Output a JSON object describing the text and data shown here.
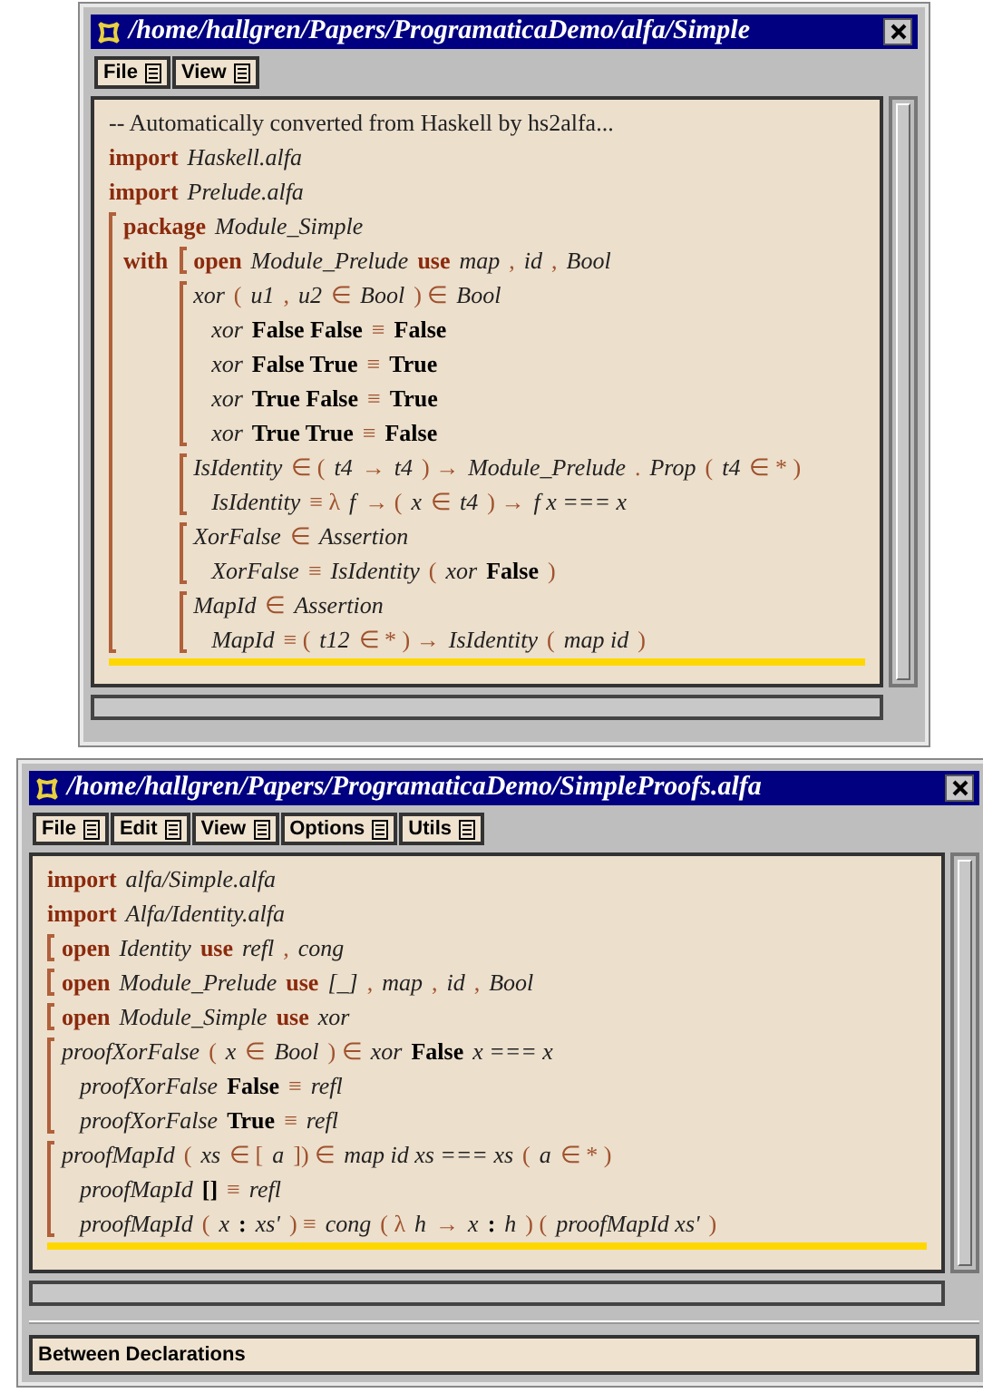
{
  "windows": [
    {
      "title": "/home/hallgren/Papers/ProgramaticaDemo/alfa/Simple",
      "menus": [
        {
          "label": "File"
        },
        {
          "label": "View"
        }
      ],
      "code": [
        {
          "kind": "line",
          "tokens": [
            {
              "kind": "txt",
              "text": "-- Automatically converted from Haskell by hs2alfa..."
            }
          ]
        },
        {
          "kind": "line",
          "tokens": [
            {
              "kind": "kw",
              "text": "import"
            },
            {
              "kind": "id",
              "text": "Haskell.alfa"
            }
          ]
        },
        {
          "kind": "line",
          "tokens": [
            {
              "kind": "kw",
              "text": "import"
            },
            {
              "kind": "id",
              "text": "Prelude.alfa"
            }
          ]
        },
        {
          "kind": "block",
          "children": [
            {
              "kind": "line",
              "tokens": [
                {
                  "kind": "kw",
                  "text": "package"
                },
                {
                  "kind": "id",
                  "text": "Module_Simple"
                }
              ]
            },
            {
              "kind": "lead",
              "tokens": [
                {
                  "kind": "kw",
                  "text": "with"
                }
              ],
              "children": [
                {
                  "kind": "block",
                  "children": [
                    {
                      "kind": "line",
                      "tokens": [
                        {
                          "kind": "kw",
                          "text": "open"
                        },
                        {
                          "kind": "id",
                          "text": "Module_Prelude"
                        },
                        {
                          "kind": "kw",
                          "text": "use"
                        },
                        {
                          "kind": "id",
                          "text": "map"
                        },
                        {
                          "kind": "sym",
                          "text": ","
                        },
                        {
                          "kind": "id",
                          "text": "id"
                        },
                        {
                          "kind": "sym",
                          "text": ","
                        },
                        {
                          "kind": "id",
                          "text": "Bool"
                        }
                      ]
                    }
                  ]
                },
                {
                  "kind": "block",
                  "children": [
                    {
                      "kind": "line",
                      "tokens": [
                        {
                          "kind": "id",
                          "text": "xor"
                        },
                        {
                          "kind": "sym",
                          "text": "("
                        },
                        {
                          "kind": "id",
                          "text": "u1"
                        },
                        {
                          "kind": "sym",
                          "text": ","
                        },
                        {
                          "kind": "id",
                          "text": "u2"
                        },
                        {
                          "kind": "sym",
                          "text": "∈"
                        },
                        {
                          "kind": "id",
                          "text": "Bool"
                        },
                        {
                          "kind": "sym",
                          "text": ") ∈"
                        },
                        {
                          "kind": "id",
                          "text": "Bool"
                        }
                      ],
                      "children": [
                        {
                          "kind": "line",
                          "tokens": [
                            {
                              "kind": "id",
                              "text": "xor"
                            },
                            {
                              "kind": "con",
                              "text": "False False"
                            },
                            {
                              "kind": "sym",
                              "text": "≡"
                            },
                            {
                              "kind": "con",
                              "text": "False"
                            }
                          ]
                        },
                        {
                          "kind": "line",
                          "tokens": [
                            {
                              "kind": "id",
                              "text": "xor"
                            },
                            {
                              "kind": "con",
                              "text": "False True"
                            },
                            {
                              "kind": "sym",
                              "text": "≡"
                            },
                            {
                              "kind": "con",
                              "text": "True"
                            }
                          ]
                        },
                        {
                          "kind": "line",
                          "tokens": [
                            {
                              "kind": "id",
                              "text": "xor"
                            },
                            {
                              "kind": "con",
                              "text": "True False"
                            },
                            {
                              "kind": "sym",
                              "text": "≡"
                            },
                            {
                              "kind": "con",
                              "text": "True"
                            }
                          ]
                        },
                        {
                          "kind": "line",
                          "tokens": [
                            {
                              "kind": "id",
                              "text": "xor"
                            },
                            {
                              "kind": "con",
                              "text": "True True"
                            },
                            {
                              "kind": "sym",
                              "text": "≡"
                            },
                            {
                              "kind": "con",
                              "text": "False"
                            }
                          ]
                        }
                      ]
                    }
                  ]
                },
                {
                  "kind": "block",
                  "children": [
                    {
                      "kind": "line",
                      "tokens": [
                        {
                          "kind": "id",
                          "text": "IsIdentity"
                        },
                        {
                          "kind": "sym",
                          "text": "∈ ("
                        },
                        {
                          "kind": "id",
                          "text": "t4"
                        },
                        {
                          "kind": "sym",
                          "text": "→"
                        },
                        {
                          "kind": "id",
                          "text": "t4"
                        },
                        {
                          "kind": "sym",
                          "text": ") →"
                        },
                        {
                          "kind": "id",
                          "text": "Module_Prelude"
                        },
                        {
                          "kind": "sym",
                          "text": "."
                        },
                        {
                          "kind": "id",
                          "text": "Prop"
                        },
                        {
                          "kind": "sym",
                          "text": "("
                        },
                        {
                          "kind": "id",
                          "text": "t4"
                        },
                        {
                          "kind": "sym",
                          "text": "∈ * )"
                        }
                      ],
                      "children": [
                        {
                          "kind": "line",
                          "tokens": [
                            {
                              "kind": "id",
                              "text": "IsIdentity"
                            },
                            {
                              "kind": "sym",
                              "text": "≡ λ"
                            },
                            {
                              "kind": "id",
                              "text": "f"
                            },
                            {
                              "kind": "sym",
                              "text": "→ ("
                            },
                            {
                              "kind": "id",
                              "text": "x"
                            },
                            {
                              "kind": "sym",
                              "text": "∈"
                            },
                            {
                              "kind": "id",
                              "text": "t4"
                            },
                            {
                              "kind": "sym",
                              "text": ") →"
                            },
                            {
                              "kind": "id",
                              "text": "f x === x"
                            }
                          ]
                        }
                      ]
                    }
                  ]
                },
                {
                  "kind": "block",
                  "children": [
                    {
                      "kind": "line",
                      "tokens": [
                        {
                          "kind": "id",
                          "text": "XorFalse"
                        },
                        {
                          "kind": "sym",
                          "text": "∈"
                        },
                        {
                          "kind": "id",
                          "text": "Assertion"
                        }
                      ],
                      "children": [
                        {
                          "kind": "line",
                          "tokens": [
                            {
                              "kind": "id",
                              "text": "XorFalse"
                            },
                            {
                              "kind": "sym",
                              "text": "≡"
                            },
                            {
                              "kind": "id",
                              "text": "IsIdentity"
                            },
                            {
                              "kind": "sym",
                              "text": "("
                            },
                            {
                              "kind": "id",
                              "text": "xor"
                            },
                            {
                              "kind": "con",
                              "text": "False"
                            },
                            {
                              "kind": "sym",
                              "text": ")"
                            }
                          ]
                        }
                      ]
                    }
                  ]
                },
                {
                  "kind": "block",
                  "children": [
                    {
                      "kind": "line",
                      "tokens": [
                        {
                          "kind": "id",
                          "text": "MapId"
                        },
                        {
                          "kind": "sym",
                          "text": "∈"
                        },
                        {
                          "kind": "id",
                          "text": "Assertion"
                        }
                      ],
                      "children": [
                        {
                          "kind": "line",
                          "tokens": [
                            {
                              "kind": "id",
                              "text": "MapId"
                            },
                            {
                              "kind": "sym",
                              "text": "≡ ("
                            },
                            {
                              "kind": "id",
                              "text": "t12"
                            },
                            {
                              "kind": "sym",
                              "text": "∈ * ) →"
                            },
                            {
                              "kind": "id",
                              "text": "IsIdentity"
                            },
                            {
                              "kind": "sym",
                              "text": "("
                            },
                            {
                              "kind": "id",
                              "text": "map id"
                            },
                            {
                              "kind": "sym",
                              "text": ")"
                            }
                          ]
                        }
                      ]
                    }
                  ]
                }
              ]
            }
          ]
        }
      ]
    },
    {
      "title": "/home/hallgren/Papers/ProgramaticaDemo/SimpleProofs.alfa",
      "menus": [
        {
          "label": "File"
        },
        {
          "label": "Edit"
        },
        {
          "label": "View"
        },
        {
          "label": "Options"
        },
        {
          "label": "Utils"
        }
      ],
      "code": [
        {
          "kind": "line",
          "tokens": [
            {
              "kind": "kw",
              "text": "import"
            },
            {
              "kind": "id",
              "text": "alfa/Simple.alfa"
            }
          ]
        },
        {
          "kind": "line",
          "tokens": [
            {
              "kind": "kw",
              "text": "import"
            },
            {
              "kind": "id",
              "text": "Alfa/Identity.alfa"
            }
          ]
        },
        {
          "kind": "block",
          "children": [
            {
              "kind": "line",
              "tokens": [
                {
                  "kind": "kw",
                  "text": "open"
                },
                {
                  "kind": "id",
                  "text": "Identity"
                },
                {
                  "kind": "kw",
                  "text": "use"
                },
                {
                  "kind": "id",
                  "text": "refl"
                },
                {
                  "kind": "sym",
                  "text": ","
                },
                {
                  "kind": "id",
                  "text": "cong"
                }
              ]
            }
          ]
        },
        {
          "kind": "block",
          "children": [
            {
              "kind": "line",
              "tokens": [
                {
                  "kind": "kw",
                  "text": "open"
                },
                {
                  "kind": "id",
                  "text": "Module_Prelude"
                },
                {
                  "kind": "kw",
                  "text": "use"
                },
                {
                  "kind": "id",
                  "text": "[_]"
                },
                {
                  "kind": "sym",
                  "text": ","
                },
                {
                  "kind": "id",
                  "text": "map"
                },
                {
                  "kind": "sym",
                  "text": ","
                },
                {
                  "kind": "id",
                  "text": "id"
                },
                {
                  "kind": "sym",
                  "text": ","
                },
                {
                  "kind": "id",
                  "text": "Bool"
                }
              ]
            }
          ]
        },
        {
          "kind": "block",
          "children": [
            {
              "kind": "line",
              "tokens": [
                {
                  "kind": "kw",
                  "text": "open"
                },
                {
                  "kind": "id",
                  "text": "Module_Simple"
                },
                {
                  "kind": "kw",
                  "text": "use"
                },
                {
                  "kind": "id",
                  "text": "xor"
                }
              ]
            }
          ]
        },
        {
          "kind": "block",
          "children": [
            {
              "kind": "line",
              "tokens": [
                {
                  "kind": "id",
                  "text": "proofXorFalse"
                },
                {
                  "kind": "sym",
                  "text": "("
                },
                {
                  "kind": "id",
                  "text": "x"
                },
                {
                  "kind": "sym",
                  "text": "∈"
                },
                {
                  "kind": "id",
                  "text": "Bool"
                },
                {
                  "kind": "sym",
                  "text": ") ∈"
                },
                {
                  "kind": "id",
                  "text": "xor"
                },
                {
                  "kind": "con",
                  "text": "False"
                },
                {
                  "kind": "id",
                  "text": "x === x"
                }
              ],
              "children": [
                {
                  "kind": "line",
                  "tokens": [
                    {
                      "kind": "id",
                      "text": "proofXorFalse"
                    },
                    {
                      "kind": "con",
                      "text": "False"
                    },
                    {
                      "kind": "sym",
                      "text": "≡"
                    },
                    {
                      "kind": "id",
                      "text": "refl"
                    }
                  ]
                },
                {
                  "kind": "line",
                  "tokens": [
                    {
                      "kind": "id",
                      "text": "proofXorFalse"
                    },
                    {
                      "kind": "con",
                      "text": "True"
                    },
                    {
                      "kind": "sym",
                      "text": "≡"
                    },
                    {
                      "kind": "id",
                      "text": "refl"
                    }
                  ]
                }
              ]
            }
          ]
        },
        {
          "kind": "block",
          "children": [
            {
              "kind": "line",
              "tokens": [
                {
                  "kind": "id",
                  "text": "proofMapId"
                },
                {
                  "kind": "sym",
                  "text": "("
                },
                {
                  "kind": "id",
                  "text": "xs"
                },
                {
                  "kind": "sym",
                  "text": "∈ ["
                },
                {
                  "kind": "id",
                  "text": "a"
                },
                {
                  "kind": "sym",
                  "text": "]) ∈"
                },
                {
                  "kind": "id",
                  "text": "map id xs === xs"
                },
                {
                  "kind": "sym",
                  "text": "("
                },
                {
                  "kind": "id",
                  "text": "a"
                },
                {
                  "kind": "sym",
                  "text": "∈ * )"
                }
              ],
              "children": [
                {
                  "kind": "line",
                  "tokens": [
                    {
                      "kind": "id",
                      "text": "proofMapId"
                    },
                    {
                      "kind": "con",
                      "text": "[]"
                    },
                    {
                      "kind": "sym",
                      "text": "≡"
                    },
                    {
                      "kind": "id",
                      "text": "refl"
                    }
                  ]
                },
                {
                  "kind": "line",
                  "tokens": [
                    {
                      "kind": "id",
                      "text": "proofMapId"
                    },
                    {
                      "kind": "sym",
                      "text": "("
                    },
                    {
                      "kind": "id",
                      "text": "x"
                    },
                    {
                      "kind": "con",
                      "text": ":"
                    },
                    {
                      "kind": "id",
                      "text": "xs'"
                    },
                    {
                      "kind": "sym",
                      "text": ") ≡"
                    },
                    {
                      "kind": "id",
                      "text": "cong"
                    },
                    {
                      "kind": "sym",
                      "text": "( λ"
                    },
                    {
                      "kind": "id",
                      "text": "h"
                    },
                    {
                      "kind": "sym",
                      "text": "→"
                    },
                    {
                      "kind": "id",
                      "text": "x"
                    },
                    {
                      "kind": "con",
                      "text": ":"
                    },
                    {
                      "kind": "id",
                      "text": "h"
                    },
                    {
                      "kind": "sym",
                      "text": ") ("
                    },
                    {
                      "kind": "id",
                      "text": "proofMapId xs'"
                    },
                    {
                      "kind": "sym",
                      "text": ")"
                    }
                  ]
                }
              ]
            }
          ]
        }
      ],
      "status": "Between Declarations"
    }
  ]
}
